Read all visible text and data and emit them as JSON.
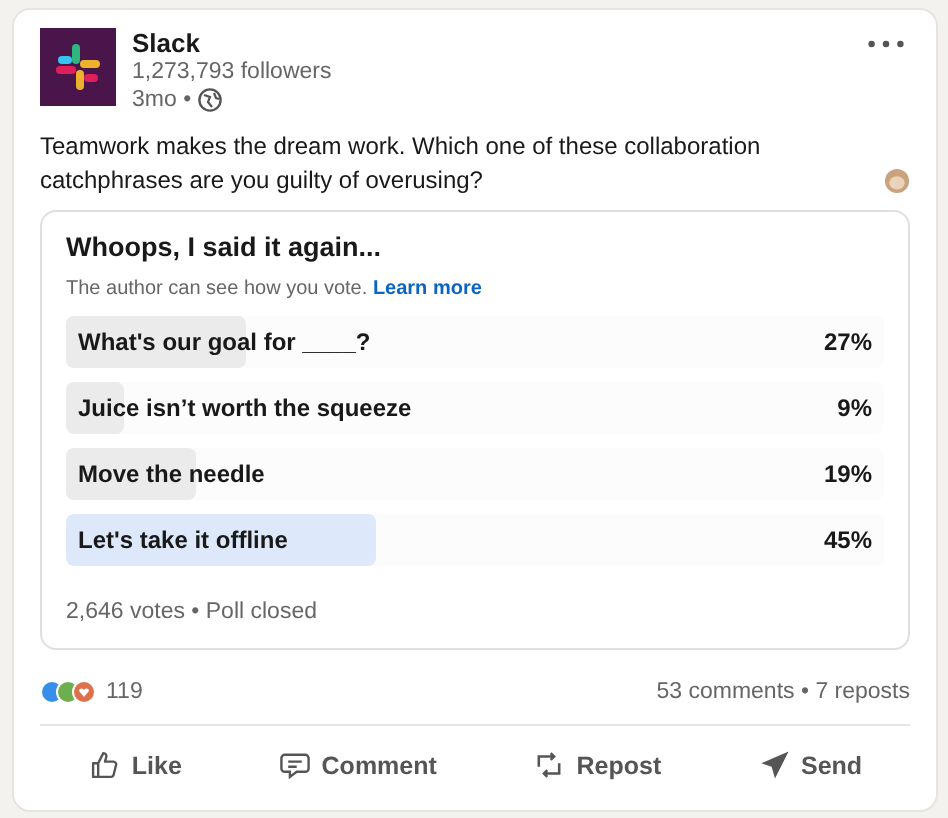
{
  "author": {
    "name": "Slack",
    "followers": "1,273,793 followers",
    "time": "3mo •"
  },
  "post_text": "Teamwork makes the dream work. Which one of these collaboration catchphrases are you guilty of overusing?",
  "poll": {
    "title": "Whoops, I said it again...",
    "notice": "The author can see how you vote.",
    "notice_link": "Learn more",
    "options": [
      {
        "label": "What's our goal for ____?",
        "percent": "27%",
        "level": 0.22,
        "selected": false
      },
      {
        "label": "Juice isn’t worth the squeeze",
        "percent": "9%",
        "level": 0.07,
        "selected": false
      },
      {
        "label": "Move the needle",
        "percent": "19%",
        "level": 0.16,
        "selected": false
      },
      {
        "label": "Let's take it offline",
        "percent": "45%",
        "level": 0.38,
        "selected": true
      }
    ],
    "footer": "2,646 votes • Poll closed"
  },
  "reactions_count": "119",
  "comments_reposts": "53 comments • 7 reposts",
  "actions": [
    {
      "kind": "like",
      "label": "Like"
    },
    {
      "kind": "comment",
      "label": "Comment"
    },
    {
      "kind": "repost",
      "label": "Repost"
    },
    {
      "kind": "send",
      "label": "Send"
    }
  ]
}
